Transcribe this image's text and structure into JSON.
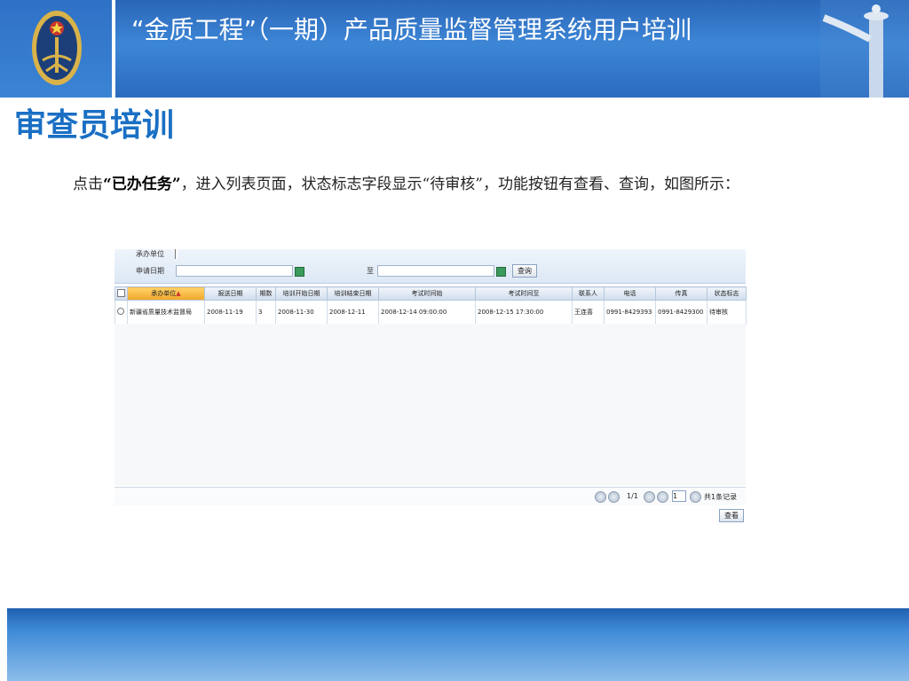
{
  "header": {
    "title": "“金质工程”（一期）产品质量监督管理系统用户培训"
  },
  "section_title": "审查员培训",
  "description": {
    "part1": "点击",
    "bold": "“已办任务”",
    "part2": "，进入列表页面，状态标志字段显示“待审核”，功能按钮有查看、查询，如图所示："
  },
  "app": {
    "filter": {
      "unit_label": "承办单位",
      "date_label": "申请日期",
      "to_label": "至",
      "query_button": "查询"
    },
    "table": {
      "columns": [
        "承办单位",
        "报送日期",
        "期数",
        "培训开始日期",
        "培训结束日期",
        "考试时间始",
        "考试时间至",
        "联系人",
        "电话",
        "传真",
        "状态标志"
      ],
      "sort_indicator": "▲",
      "rows": [
        [
          "新疆省质量技术监督局",
          "2008-11-19",
          "3",
          "2008-11-30",
          "2008-12-11",
          "2008-12-14 09:00:00",
          "2008-12-15 17:30:00",
          "王连喜",
          "0991-8429393",
          "0991-8429300",
          "待审核"
        ]
      ]
    },
    "pager": {
      "page_info": "1/1",
      "page_input": "1",
      "total": "共1条记录"
    },
    "view_button": "查看"
  }
}
